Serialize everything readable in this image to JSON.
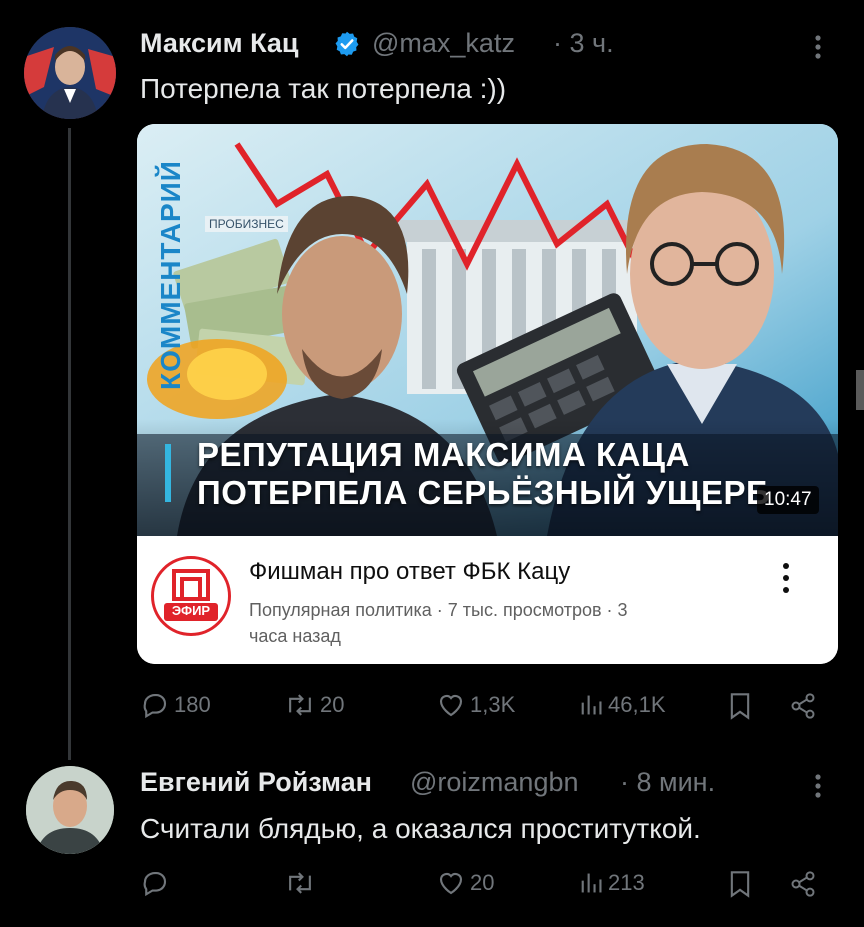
{
  "tweet": {
    "author_name": "Максим Кац",
    "handle": "@max_katz",
    "time": "· 3 ч.",
    "text": "Потерпела так потерпела :))",
    "stats": {
      "replies": "180",
      "retweets": "20",
      "likes": "1,3K",
      "views": "46,1K"
    }
  },
  "video": {
    "vertical_label": "КОММЕНТАРИЙ",
    "bg_text": "ПРОБИЗНЕС",
    "headline_1": "РЕПУТАЦИЯ МАКСИМА КАЦА",
    "headline_2": "ПОТЕРПЕЛА СЕРЬЁЗНЫЙ УЩЕРБ",
    "duration": "10:47",
    "title": "Фишман про ответ ФБК Кацу",
    "meta_1": "Популярная политика · 7 тыс. просмотров · 3",
    "meta_2": "часа назад",
    "channel_badge": "ЭФИР"
  },
  "reply": {
    "author_name": "Евгений Ройзман",
    "handle": "@roizmangbn",
    "time": "· 8 мин.",
    "text": "Считали блядью, а оказался проституткой.",
    "stats": {
      "likes": "20",
      "views": "213"
    }
  },
  "colors": {
    "verified": "#1d9bf0",
    "muted": "#71767b",
    "accent_red": "#e0232a"
  }
}
